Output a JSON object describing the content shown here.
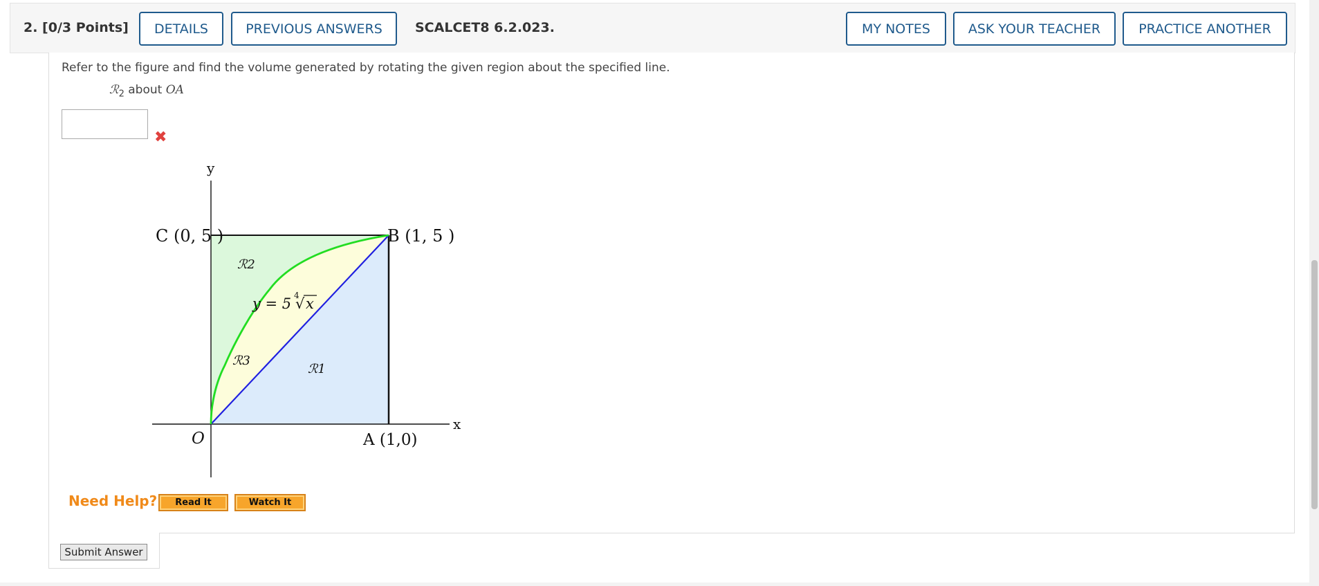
{
  "header": {
    "question_number": "2.  [0/3 Points]",
    "details_label": "DETAILS",
    "previous_answers_label": "PREVIOUS ANSWERS",
    "question_code": "SCALCET8 6.2.023.",
    "my_notes_label": "MY NOTES",
    "ask_teacher_label": "ASK YOUR TEACHER",
    "practice_another_label": "PRACTICE ANOTHER"
  },
  "question": {
    "prompt": "Refer to the figure and find the volume generated by rotating the given region about the specified line.",
    "region_symbol": "ℛ",
    "region_subscript": "2",
    "about_text": "about",
    "axis_line": "OA",
    "answer_value": "",
    "answer_status": "incorrect",
    "answer_status_icon": "✖"
  },
  "figure": {
    "y_axis_label": "y",
    "x_axis_label": "x",
    "point_c_label": "C (0, 5 )",
    "point_b_label": "B (1, 5 )",
    "point_a_label": "A (1,0)",
    "origin_label": "O",
    "region_r1": "ℛ1",
    "region_r2": "ℛ2",
    "region_r3": "ℛ3",
    "curve_lhs": "y = 5",
    "curve_root_index": "4",
    "curve_radical": "√",
    "curve_variable": "x",
    "colors": {
      "curve": "#22dd22",
      "diagonal": "#1f1fe0",
      "region_r1_fill": "#dcebfb",
      "region_r2_fill": "#dcf8dc",
      "region_r3_fill": "#fdfddb"
    }
  },
  "help": {
    "need_help_label": "Need Help?",
    "read_it_label": "Read It",
    "watch_it_label": "Watch It"
  },
  "submit": {
    "submit_label": "Submit Answer"
  }
}
